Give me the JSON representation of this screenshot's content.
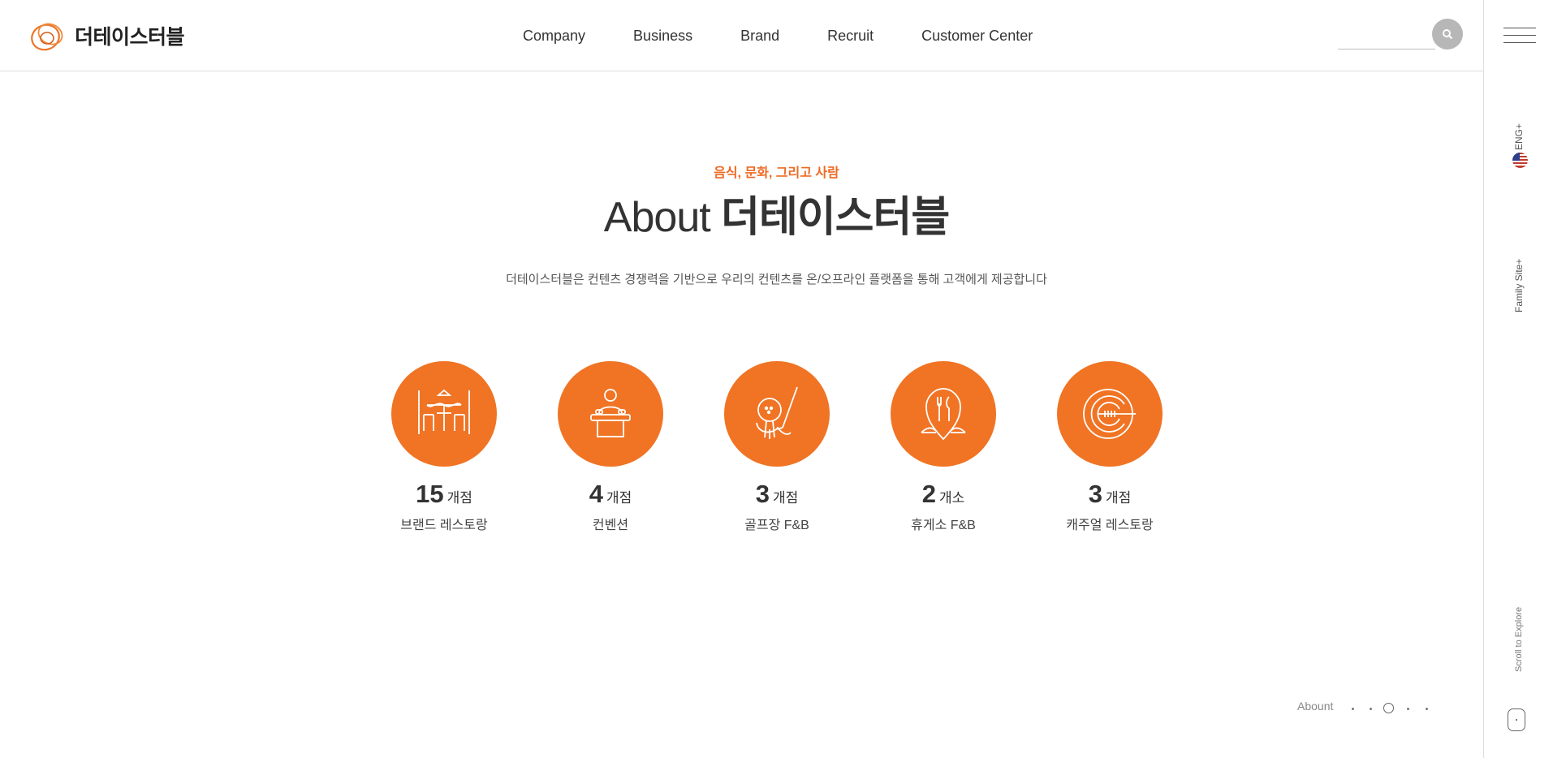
{
  "brand": {
    "name": "더테이스터블",
    "accent": "#f07424"
  },
  "nav": [
    "Company",
    "Business",
    "Brand",
    "Recruit",
    "Customer Center"
  ],
  "search": {
    "placeholder": "",
    "icon": "search-icon"
  },
  "rail": {
    "lang": "ENG+",
    "family": "Family Site+",
    "scroll": "Scroll to Explore"
  },
  "about": {
    "kicker": "음식, 문화, 그리고 사람",
    "title_light": "About",
    "title_bold": "더테이스터블",
    "description": "더테이스터블은 컨텐츠 경쟁력을 기반으로 우리의 컨텐츠를 온/오프라인 플랫폼을 통해 고객에게 제공합니다"
  },
  "stats": [
    {
      "num": "15",
      "unit": "개점",
      "label": "브랜드 레스토랑",
      "icon": "restaurant-icon"
    },
    {
      "num": "4",
      "unit": "개점",
      "label": "컨벤션",
      "icon": "convention-icon"
    },
    {
      "num": "3",
      "unit": "개점",
      "label": "골프장 F&B",
      "icon": "golf-icon"
    },
    {
      "num": "2",
      "unit": "개소",
      "label": "휴게소 F&B",
      "icon": "rest-area-icon"
    },
    {
      "num": "3",
      "unit": "개점",
      "label": "캐주얼 레스토랑",
      "icon": "casual-dining-icon"
    }
  ],
  "pager": {
    "label": "Abount",
    "total": 5,
    "active": 3
  }
}
